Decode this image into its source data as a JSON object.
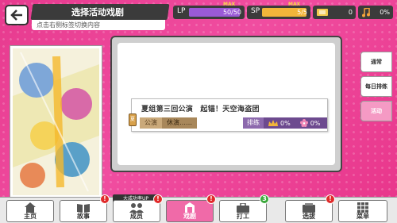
{
  "header": {
    "title": "选择活动戏剧",
    "subtitle": "点击右侧标签切换内容"
  },
  "stats": {
    "lp_label": "LP",
    "lp_value": "50/50",
    "lp_max": "MAX",
    "lp_fill": 1.0,
    "sp_label": "SP",
    "sp_value": "5/5",
    "sp_max": "MAX",
    "sp_fill": 1.0,
    "gem_value": "0",
    "note_value": "0%"
  },
  "play": {
    "name": "夏组第三回公演　起锚！天空海盗团",
    "tag_status": "公演",
    "tag_rest": "休演……",
    "rank_label": "排练",
    "crown_value": "0%",
    "flower_value": "0%"
  },
  "side_tabs": [
    "通常",
    "每日排练",
    "活动"
  ],
  "nav": {
    "items": [
      "主页",
      "故事",
      "成员",
      "戏剧",
      "打工",
      "选拔",
      "菜单"
    ],
    "up_label": "大成功率UP",
    "work_badge": "3"
  },
  "colors": {
    "accent": "#e73a8e",
    "lp": "#9a5ad6",
    "sp": "#f2b53a"
  }
}
